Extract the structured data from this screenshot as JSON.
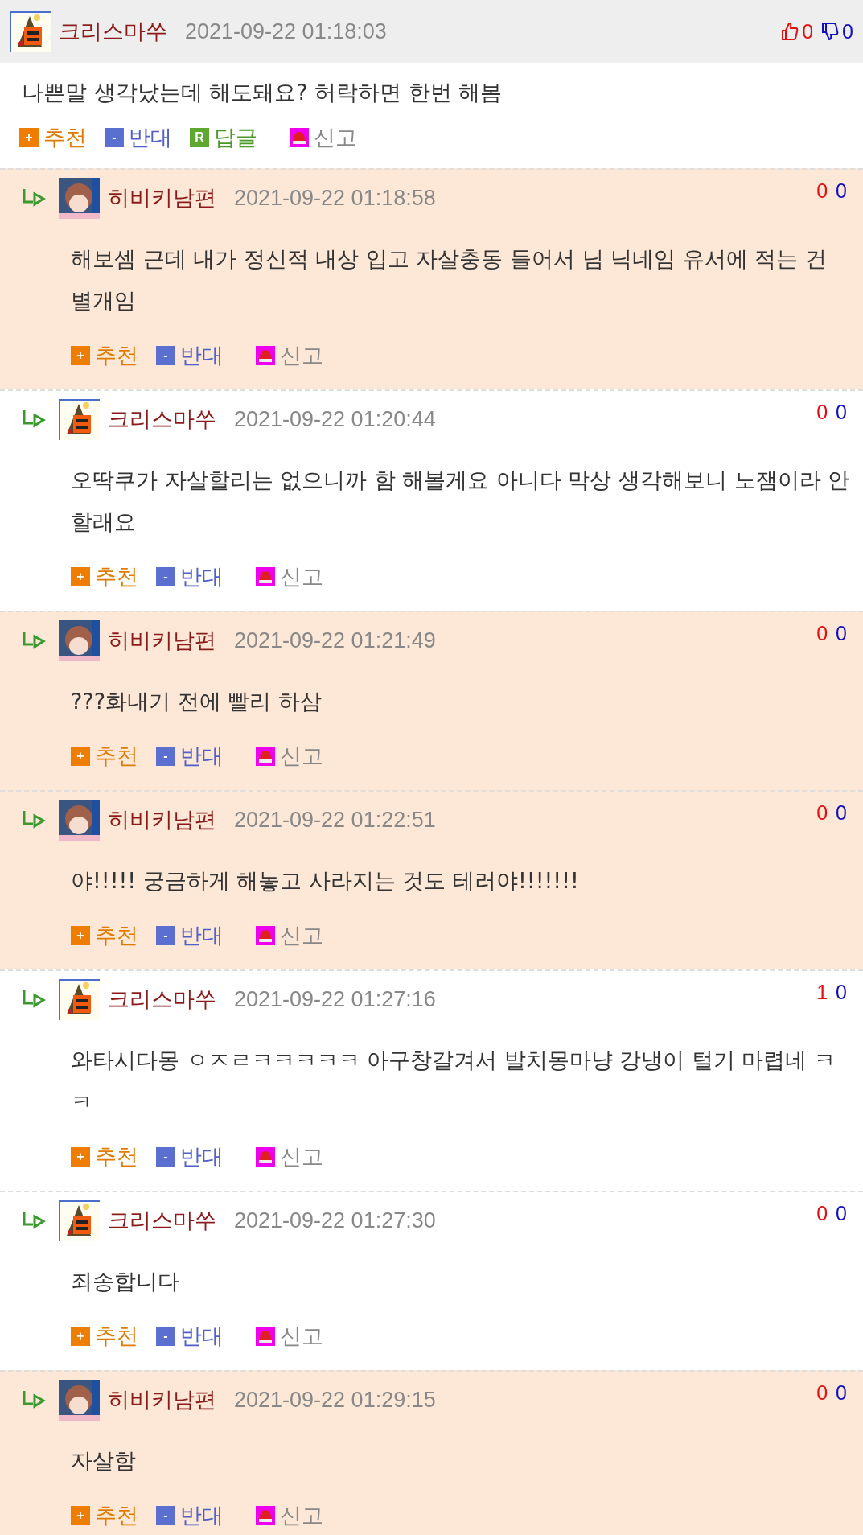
{
  "post": {
    "author": "크리스마쑤",
    "avatar": {
      "kind": "picture"
    },
    "date": "2021-09-22 01:18:03",
    "up_count": "0",
    "down_count": "0",
    "body": "나쁜말 생각났는데 해도돼요? 허락하면 한번 해봄",
    "actions": [
      {
        "kind": "up",
        "icon": "+",
        "label": "추천"
      },
      {
        "kind": "down",
        "icon": "-",
        "label": "반대"
      },
      {
        "kind": "reply",
        "icon": "R",
        "label": "답글"
      },
      {
        "kind": "report",
        "label": "신고"
      }
    ]
  },
  "replies": [
    {
      "author": "히비키남편",
      "avatar": {
        "kind": "picture"
      },
      "shaded": true,
      "date": "2021-09-22 01:18:58",
      "up_count": "0",
      "down_count": "0",
      "body": "해보셈 근데 내가 정신적 내상 입고 자살충동 들어서 님 닉네임 유서에 적는 건 별개임",
      "actions": [
        {
          "kind": "up",
          "icon": "+",
          "label": "추천"
        },
        {
          "kind": "down",
          "icon": "-",
          "label": "반대"
        },
        {
          "kind": "report",
          "label": "신고"
        }
      ]
    },
    {
      "author": "크리스마쑤",
      "avatar": {
        "kind": "picture"
      },
      "shaded": false,
      "date": "2021-09-22 01:20:44",
      "up_count": "0",
      "down_count": "0",
      "body": "오딱쿠가 자살할리는 없으니까 함 해볼게요 아니다 막상 생각해보니 노잼이라 안할래요",
      "actions": [
        {
          "kind": "up",
          "icon": "+",
          "label": "추천"
        },
        {
          "kind": "down",
          "icon": "-",
          "label": "반대"
        },
        {
          "kind": "report",
          "label": "신고"
        }
      ]
    },
    {
      "author": "히비키남편",
      "avatar": {
        "kind": "picture"
      },
      "shaded": true,
      "date": "2021-09-22 01:21:49",
      "up_count": "0",
      "down_count": "0",
      "body": "???화내기 전에 빨리 하삼",
      "actions": [
        {
          "kind": "up",
          "icon": "+",
          "label": "추천"
        },
        {
          "kind": "down",
          "icon": "-",
          "label": "반대"
        },
        {
          "kind": "report",
          "label": "신고"
        }
      ]
    },
    {
      "author": "히비키남편",
      "avatar": {
        "kind": "picture"
      },
      "shaded": true,
      "date": "2021-09-22 01:22:51",
      "up_count": "0",
      "down_count": "0",
      "body": "야!!!!! 궁금하게 해놓고 사라지는 것도 테러야!!!!!!!",
      "actions": [
        {
          "kind": "up",
          "icon": "+",
          "label": "추천"
        },
        {
          "kind": "down",
          "icon": "-",
          "label": "반대"
        },
        {
          "kind": "report",
          "label": "신고"
        }
      ]
    },
    {
      "author": "크리스마쑤",
      "avatar": {
        "kind": "picture"
      },
      "shaded": false,
      "date": "2021-09-22 01:27:16",
      "up_count": "1",
      "down_count": "0",
      "body": "와타시다몽 ㅇㅈㄹㅋㅋㅋㅋㅋ 아구창갈겨서 발치몽마냥 강냉이 털기 마렵네 ㅋㅋ",
      "actions": [
        {
          "kind": "up",
          "icon": "+",
          "label": "추천"
        },
        {
          "kind": "down",
          "icon": "-",
          "label": "반대"
        },
        {
          "kind": "report",
          "label": "신고"
        }
      ]
    },
    {
      "author": "크리스마쑤",
      "avatar": {
        "kind": "picture"
      },
      "shaded": false,
      "date": "2021-09-22 01:27:30",
      "up_count": "0",
      "down_count": "0",
      "body": "죄송합니다",
      "actions": [
        {
          "kind": "up",
          "icon": "+",
          "label": "추천"
        },
        {
          "kind": "down",
          "icon": "-",
          "label": "반대"
        },
        {
          "kind": "report",
          "label": "신고"
        }
      ]
    },
    {
      "author": "히비키남편",
      "avatar": {
        "kind": "picture"
      },
      "shaded": true,
      "date": "2021-09-22 01:29:15",
      "up_count": "0",
      "down_count": "0",
      "body": "자살함",
      "actions": [
        {
          "kind": "up",
          "icon": "+",
          "label": "추천"
        },
        {
          "kind": "down",
          "icon": "-",
          "label": "반대"
        },
        {
          "kind": "report",
          "label": "신고"
        }
      ]
    }
  ]
}
